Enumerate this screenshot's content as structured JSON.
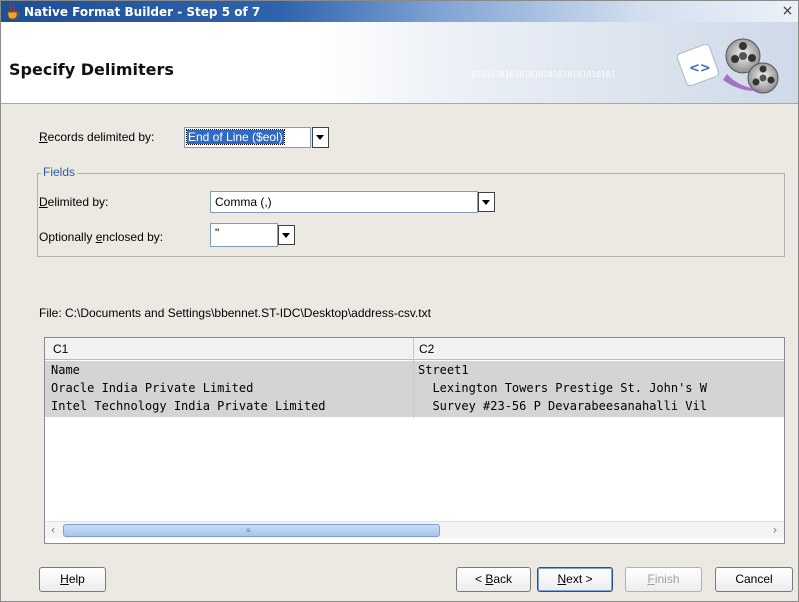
{
  "window": {
    "title": "Native Format Builder - Step 5 of 7",
    "close_glyph": "×"
  },
  "banner": {
    "heading": "Specify Delimiters",
    "binary_text": "010101010101010101010101010101"
  },
  "records": {
    "label_prefix": "",
    "label_accel": "R",
    "label_rest": "ecords delimited by:",
    "value": "End of Line ($eol)"
  },
  "fields": {
    "legend": "Fields",
    "delimited_by": {
      "label_accel": "D",
      "label_rest": "elimited by:",
      "value": "Comma (,)"
    },
    "enclosed_by": {
      "label_prefix": "Optionally ",
      "label_accel": "e",
      "label_rest": "nclosed by:",
      "value": "\""
    }
  },
  "file": {
    "label": "File: C:\\Documents and Settings\\bbennet.ST-IDC\\Desktop\\address-csv.txt"
  },
  "table": {
    "columns": [
      "C1",
      "C2"
    ],
    "rows": [
      [
        "Name",
        "Street1"
      ],
      [
        "Oracle India Private Limited",
        "  Lexington Towers Prestige St. John's W"
      ],
      [
        "Intel Technology India Private Limited",
        "  Survey #23-56 P Devarabeesanahalli Vil"
      ]
    ]
  },
  "buttons": {
    "help": {
      "accel": "H",
      "rest": "elp"
    },
    "back": {
      "prefix": "< ",
      "accel": "B",
      "rest": "ack"
    },
    "next": {
      "accel": "N",
      "rest": "ext >"
    },
    "finish": {
      "accel": "F",
      "rest": "inish"
    },
    "cancel": "Cancel"
  },
  "icons": {
    "title": "java-cup-icon",
    "banner": "film-reel-wizard-icon"
  }
}
